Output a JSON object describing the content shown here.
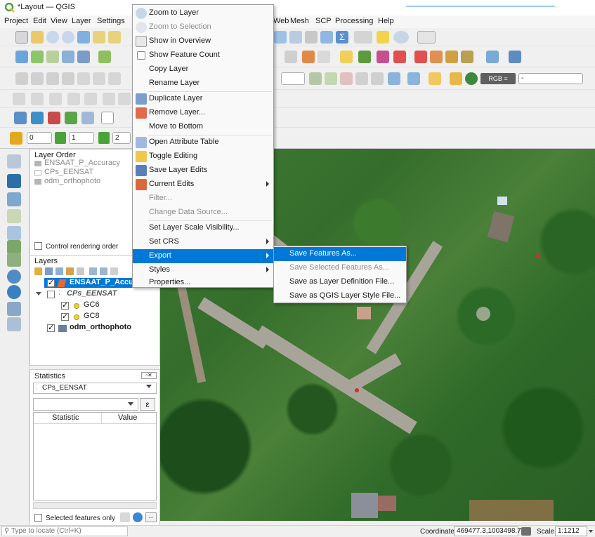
{
  "window": {
    "title": "*Layout — QGIS"
  },
  "menubar": [
    "Project",
    "Edit",
    "View",
    "Layer",
    "Settings",
    "Web",
    "Mesh",
    "SCP",
    "Processing",
    "Help"
  ],
  "toolbar": {
    "page_spin_1": "0",
    "page_spin_2": "1",
    "page_spin_3": "2",
    "rgb_combo": "RGB =",
    "rgb_value": "-"
  },
  "layer_order": {
    "title": "Layer Order",
    "items": [
      "ENSAAT_P_Accuracy",
      "CPs_EENSAT",
      "odm_orthophoto"
    ],
    "control_label": "Control rendering order"
  },
  "layers": {
    "title": "Layers",
    "items": [
      {
        "label": "ENSAAT_P_Accuracy"
      },
      {
        "label": "CPs_EENSAT"
      },
      {
        "label": "GC6"
      },
      {
        "label": "GC8"
      },
      {
        "label": "odm_orthophoto"
      }
    ]
  },
  "statistics": {
    "title": "Statistics",
    "layer": "CPs_EENSAT",
    "field_value": "",
    "expr_button": "ε",
    "col_statistic": "Statistic",
    "col_value": "Value",
    "selected_only": "Selected features only"
  },
  "context_menu": {
    "items": [
      {
        "label": "Zoom to Layer",
        "disabled": false
      },
      {
        "label": "Zoom to Selection",
        "disabled": true
      },
      {
        "label": "Show in Overview",
        "disabled": false
      },
      {
        "label": "Show Feature Count",
        "disabled": false
      },
      {
        "label": "Copy Layer",
        "disabled": false
      },
      {
        "label": "Rename Layer",
        "disabled": false
      },
      {
        "label": "Duplicate Layer",
        "disabled": false
      },
      {
        "label": "Remove Layer...",
        "disabled": false
      },
      {
        "label": "Move to Bottom",
        "disabled": false
      },
      {
        "label": "Open Attribute Table",
        "disabled": false
      },
      {
        "label": "Toggle Editing",
        "disabled": false
      },
      {
        "label": "Save Layer Edits",
        "disabled": false
      },
      {
        "label": "Current Edits",
        "disabled": false
      },
      {
        "label": "Filter...",
        "disabled": true
      },
      {
        "label": "Change Data Source...",
        "disabled": true
      },
      {
        "label": "Set Layer Scale Visibility...",
        "disabled": false
      },
      {
        "label": "Set CRS",
        "disabled": false
      },
      {
        "label": "Export",
        "disabled": false
      },
      {
        "label": "Styles",
        "disabled": false
      },
      {
        "label": "Properties...",
        "disabled": false
      }
    ]
  },
  "export_submenu": {
    "items": [
      {
        "label": "Save Features As...",
        "disabled": false
      },
      {
        "label": "Save Selected Features As...",
        "disabled": true
      },
      {
        "label": "Save as Layer Definition File...",
        "disabled": false
      },
      {
        "label": "Save as QGIS Layer Style File...",
        "disabled": false
      }
    ]
  },
  "statusbar": {
    "locate_placeholder": "Type to locate (Ctrl+K)",
    "coordinate_label": "Coordinate",
    "coordinate_value": "469477.3,1003498.7",
    "scale_label": "Scale",
    "scale_value": "1:1212"
  },
  "colors": {
    "highlight": "#0078d7",
    "map_vegetation": "#2f6a29",
    "road": "#a9a49a"
  }
}
